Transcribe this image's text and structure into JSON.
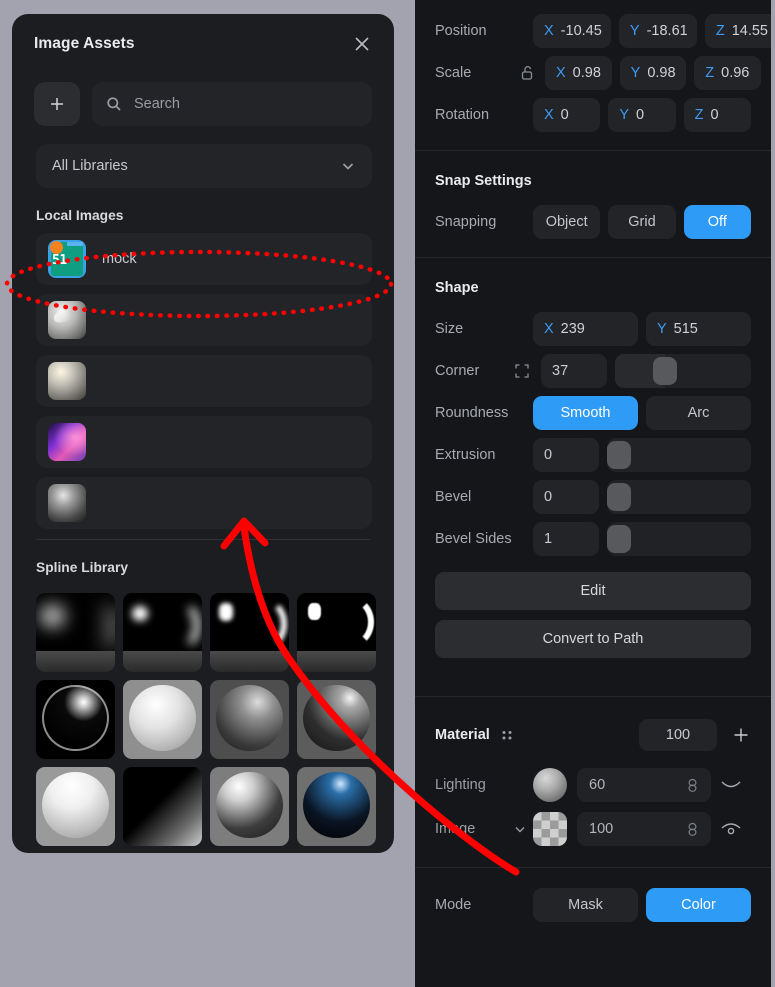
{
  "left_panel": {
    "title": "Image Assets",
    "close_icon": "close-icon",
    "add_icon": "plus-icon",
    "search": {
      "placeholder": "Search",
      "value": "",
      "icon": "search-icon"
    },
    "library_select": {
      "value": "All Libraries",
      "icon": "chevron-down-icon"
    },
    "local_images_heading": "Local Images",
    "assets": [
      {
        "label": "mock",
        "thumb": "weather-card-51",
        "highlighted": true
      },
      {
        "label": "",
        "thumb": "chrome-disc",
        "highlighted": false
      },
      {
        "label": "",
        "thumb": "metal-sphere",
        "highlighted": false
      },
      {
        "label": "",
        "thumb": "purple-gradient",
        "highlighted": false
      },
      {
        "label": "",
        "thumb": "dark-metal-ball",
        "highlighted": false
      }
    ],
    "spline_library_heading": "Spline Library",
    "spline_items": [
      "studio-soft-left",
      "studio-highlight",
      "studio-sharp-arc",
      "studio-hard-arc",
      "glass-dark-ball",
      "matte-white-ball",
      "matte-dark-ball",
      "glossy-dark-ball",
      "glossy-white-ball",
      "gradient-black",
      "shiny-chrome-ball",
      "blue-black-ball"
    ]
  },
  "right_panel": {
    "transform": {
      "rows": [
        {
          "label": "Position",
          "fields": [
            {
              "axis": "X",
              "value": "-10.45"
            },
            {
              "axis": "Y",
              "value": "-18.61"
            },
            {
              "axis": "Z",
              "value": "14.55"
            }
          ]
        },
        {
          "label": "Scale",
          "lock_icon": "unlock-icon",
          "fields": [
            {
              "axis": "X",
              "value": "0.98"
            },
            {
              "axis": "Y",
              "value": "0.98"
            },
            {
              "axis": "Z",
              "value": "0.96"
            }
          ]
        },
        {
          "label": "Rotation",
          "fields": [
            {
              "axis": "X",
              "value": "0"
            },
            {
              "axis": "Y",
              "value": "0"
            },
            {
              "axis": "Z",
              "value": "0"
            }
          ]
        }
      ]
    },
    "snap_settings": {
      "heading": "Snap Settings",
      "snapping_label": "Snapping",
      "options": [
        "Object",
        "Grid",
        "Off"
      ],
      "selected": "Off"
    },
    "shape": {
      "heading": "Shape",
      "size_label": "Size",
      "size_x": {
        "axis": "X",
        "value": "239"
      },
      "size_y": {
        "axis": "Y",
        "value": "515"
      },
      "corner_label": "Corner",
      "corner_icon": "corner-radius-icon",
      "corner_value": "37",
      "corner_pct": 37,
      "roundness_label": "Roundness",
      "roundness_options": [
        "Smooth",
        "Arc"
      ],
      "roundness_selected": "Smooth",
      "extrusion_label": "Extrusion",
      "extrusion_value": "0",
      "extrusion_pct": 0,
      "bevel_label": "Bevel",
      "bevel_value": "0",
      "bevel_pct": 0,
      "bevel_sides_label": "Bevel Sides",
      "bevel_sides_value": "1",
      "bevel_sides_pct": 0,
      "edit_button": "Edit",
      "convert_button": "Convert to Path"
    },
    "material": {
      "heading": "Material",
      "drag_icon": "drag-dots-icon",
      "opacity_value": "100",
      "add_icon": "plus-icon",
      "layers": [
        {
          "label": "Lighting",
          "swatch": "sphere-swatch",
          "value": "60",
          "lock_icon": "blend-icon",
          "tail_icon": "curve-icon",
          "has_chevron": false
        },
        {
          "label": "Image",
          "swatch": "checker-swatch",
          "value": "100",
          "lock_icon": "blend-icon",
          "tail_icon": "eye-icon",
          "has_chevron": true
        }
      ],
      "mode_label": "Mode",
      "mode_options": [
        "Mask",
        "Color"
      ],
      "mode_selected": "Color"
    }
  },
  "annotations": {
    "highlight_color": "#ff0000",
    "ellipse_target": "mock",
    "arrow_from": "Lighting",
    "arrow_to": "local-images-list"
  },
  "colors": {
    "accent": "#2e9bf7",
    "axis": "#3d9bf7",
    "panel_bg": "#1c1d20",
    "right_bg": "#151619",
    "field_bg": "#232428",
    "page_bg": "#a3a3af",
    "annotation": "#ff0000"
  }
}
